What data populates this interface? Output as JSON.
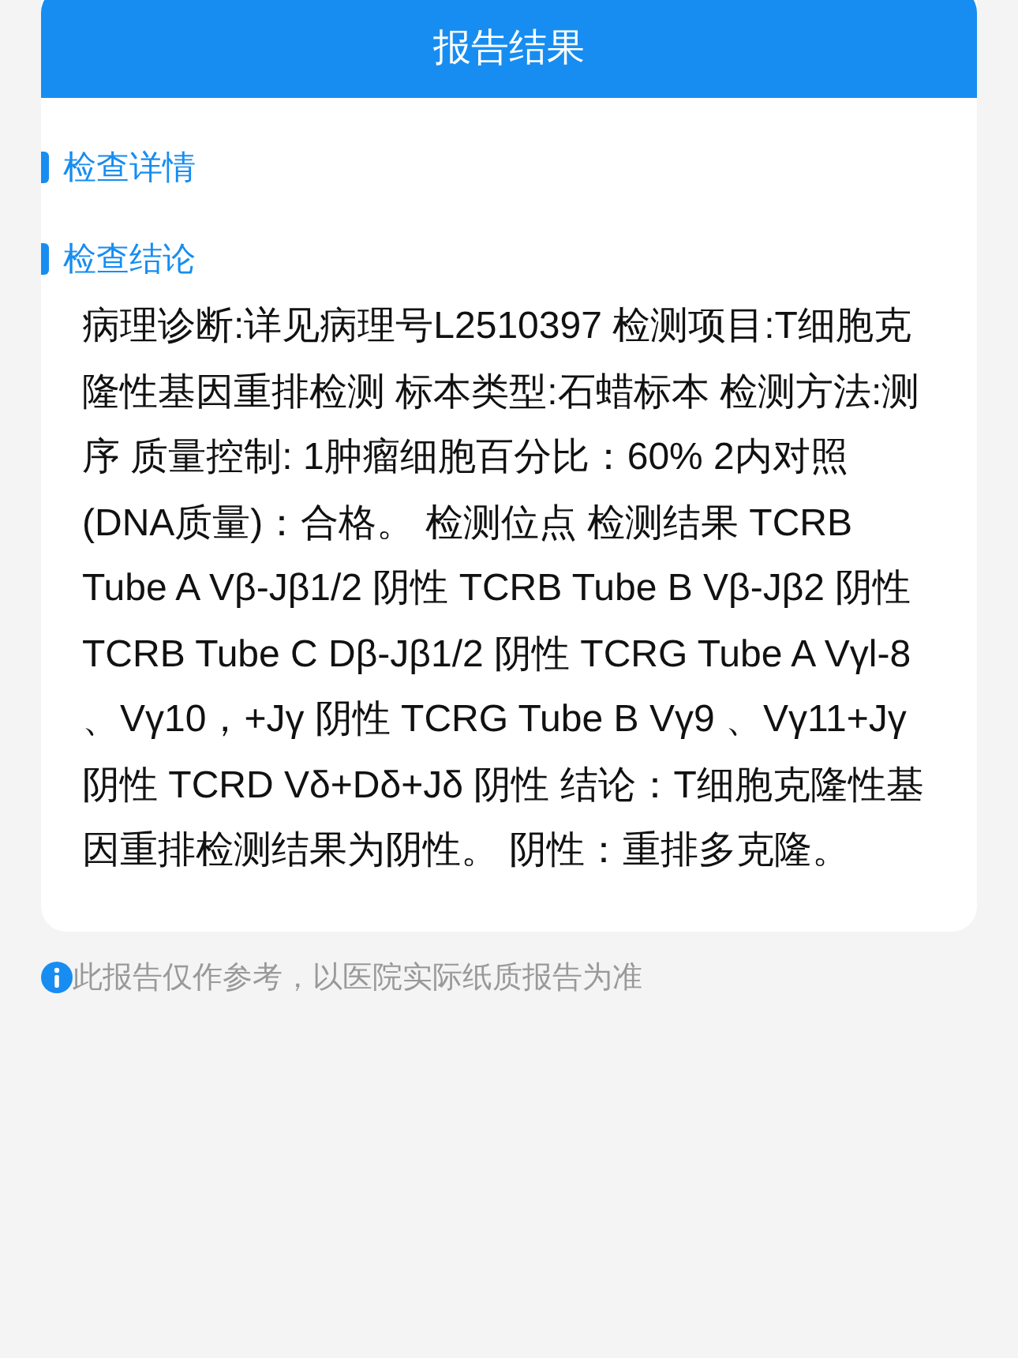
{
  "header": {
    "title": "报告结果"
  },
  "sections": [
    {
      "title": "检查详情"
    },
    {
      "title": "检查结论",
      "body": "病理诊断:详见病理号L2510397 检测项目:T细胞克隆性基因重排检测 标本类型:石蜡标本 检测方法:测序 质量控制: 1肿瘤细胞百分比：60% 2内对照(DNA质量)：合格。  检测位点 检测结果 TCRB Tube A Vβ-Jβ1/2 阴性 TCRB Tube B Vβ-Jβ2 阴性 TCRB Tube C Dβ-Jβ1/2 阴性 TCRG Tube A Vγl-8 、Vγ10，+Jγ 阴性 TCRG Tube B Vγ9 、Vγ11+Jγ 阴性 TCRD Vδ+Dδ+Jδ 阴性 结论：T细胞克隆性基因重排检测结果为阴性。 阴性：重排多克隆。"
    }
  ],
  "footnote": "此报告仅作参考，以医院实际纸质报告为准"
}
